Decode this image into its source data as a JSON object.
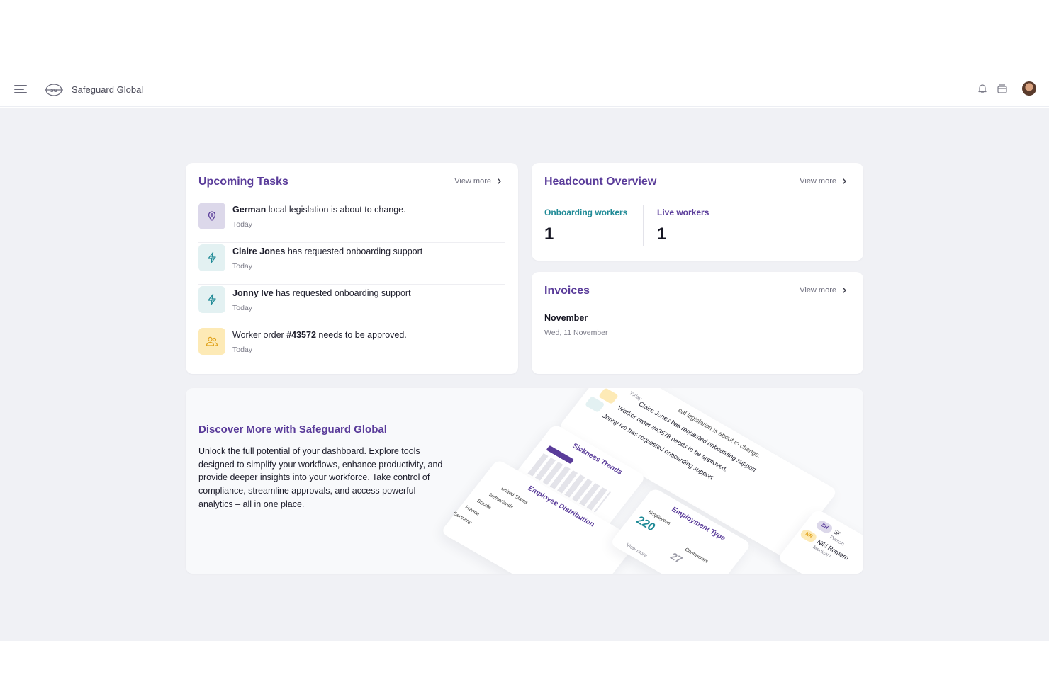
{
  "app": {
    "brand": "Safeguard Global"
  },
  "icons": {
    "menu": "hamburger-menu-icon",
    "logo": "safeguard-logo",
    "bell": "bell-icon",
    "inbox": "inbox-icon",
    "avatar": "user-avatar"
  },
  "colors": {
    "accent": "#5a3c9a",
    "teal": "#1f8a96",
    "background": "#f0f1f5"
  },
  "tasks": {
    "title": "Upcoming Tasks",
    "view_more": "View more",
    "items": [
      {
        "bold": "German",
        "rest": " local legislation is about to change.",
        "date": "Today",
        "icon": "location-pin-icon"
      },
      {
        "bold": "Claire Jones",
        "rest": " has requested onboarding support",
        "date": "Today",
        "icon": "lightning-icon"
      },
      {
        "bold": "Jonny Ive",
        "rest": " has requested onboarding support",
        "date": "Today",
        "icon": "lightning-icon"
      },
      {
        "pre": "Worker order ",
        "bold": "#43572",
        "rest": " needs to be approved.",
        "date": "Today",
        "icon": "users-icon"
      }
    ]
  },
  "headcount": {
    "title": "Headcount Overview",
    "view_more": "View more",
    "onboarding_label": "Onboarding workers",
    "onboarding_value": "1",
    "live_label": "Live workers",
    "live_value": "1"
  },
  "invoices": {
    "title": "Invoices",
    "view_more": "View more",
    "month": "November",
    "date": "Wed, 11 November"
  },
  "discover": {
    "title": "Discover More with Safeguard Global",
    "body": "Unlock the full potential of your dashboard. Explore tools designed to simplify your workflows, enhance productivity, and provide deeper insights into your workforce. Take control of compliance, streamline approvals, and access powerful analytics – all in one place.",
    "illustration": {
      "tasks_lines": [
        "Claire Jones has requested onboarding support",
        "Worker order #43578 needs to be approved.",
        "Jonny Ive has requested onboarding support"
      ],
      "tasks_top": "cal legislation is about to change.",
      "today": "Today",
      "sickness_title": "Sickness Trends",
      "employee_title": "Employee Distribution",
      "countries": [
        "United States",
        "Netherlands",
        "Brazile",
        "France",
        "Germany"
      ],
      "employment_title": "Employment Type",
      "employees_label": "Employees",
      "employees_value": "220",
      "contractors_label": "Contractors",
      "contractors_value": "27",
      "view_more": "View more",
      "people": [
        {
          "initials": "SH",
          "name": "St",
          "role": "Person"
        },
        {
          "initials": "NR",
          "name": "Niki Romero",
          "role": "Medical l"
        }
      ]
    }
  }
}
